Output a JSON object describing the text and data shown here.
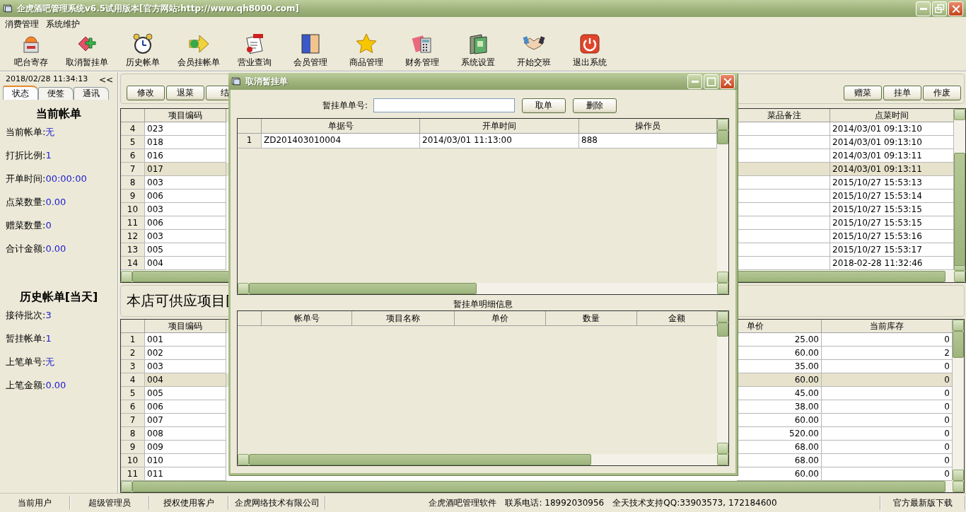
{
  "window": {
    "title": "企虎酒吧管理系统v6.5试用版本[官方网站:http://www.qh8000.com]"
  },
  "menu": [
    "消费管理",
    "系统维护"
  ],
  "toolbar": [
    {
      "label": "吧台寄存"
    },
    {
      "label": "取消暂挂单"
    },
    {
      "label": "历史帐单"
    },
    {
      "label": "会员挂帐单"
    },
    {
      "label": "营业查询"
    },
    {
      "label": "会员管理"
    },
    {
      "label": "商品管理"
    },
    {
      "label": "财务管理"
    },
    {
      "label": "系统设置"
    },
    {
      "label": "开始交班"
    },
    {
      "label": "退出系统"
    }
  ],
  "sidebar": {
    "clock": "2018/02/28 11:34:13",
    "collapse": "<<",
    "tabs": [
      {
        "label": "状态",
        "selected": true
      },
      {
        "label": "便签",
        "selected": false
      },
      {
        "label": "通讯",
        "selected": false
      }
    ],
    "sections": [
      {
        "title": "当前帐单",
        "fields": [
          {
            "label": "当前帐单:",
            "value": "无"
          },
          {
            "label": "打折比例:",
            "value": "1"
          },
          {
            "label": "开单时间:",
            "value": "00:00:00"
          },
          {
            "label": "点菜数量:",
            "value": "0.00"
          },
          {
            "label": "赠菜数量:",
            "value": "0"
          },
          {
            "label": "合计金额:",
            "value": "0.00"
          }
        ]
      },
      {
        "title": "历史帐单[当天]",
        "fields": [
          {
            "label": "接待批次:",
            "value": "3"
          },
          {
            "label": "暂挂帐单:",
            "value": "1"
          },
          {
            "label": "上笔单号:",
            "value": "无"
          },
          {
            "label": "上笔金额:",
            "value": "0.00"
          }
        ]
      }
    ]
  },
  "order_buttons_left": [
    "修改",
    "退菜",
    "结"
  ],
  "order_buttons_right": [
    "赠菜",
    "挂单",
    "作废"
  ],
  "orders_table": {
    "columns": [
      "项目编码",
      "菜品备注",
      "点菜时间"
    ],
    "rows": [
      {
        "number": "4",
        "code": "023",
        "time": "2014/03/01 09:13:10",
        "selected": false
      },
      {
        "number": "5",
        "code": "018",
        "time": "2014/03/01 09:13:10",
        "selected": false
      },
      {
        "number": "6",
        "code": "016",
        "time": "2014/03/01 09:13:11",
        "selected": false
      },
      {
        "number": "7",
        "code": "017",
        "time": "2014/03/01 09:13:11",
        "selected": true
      },
      {
        "number": "8",
        "code": "003",
        "time": "2015/10/27 15:53:13",
        "selected": false
      },
      {
        "number": "9",
        "code": "006",
        "time": "2015/10/27 15:53:14",
        "selected": false
      },
      {
        "number": "10",
        "code": "003",
        "time": "2015/10/27 15:53:15",
        "selected": false
      },
      {
        "number": "11",
        "code": "006",
        "time": "2015/10/27 15:53:15",
        "selected": false
      },
      {
        "number": "12",
        "code": "003",
        "time": "2015/10/27 15:53:16",
        "selected": false
      },
      {
        "number": "13",
        "code": "005",
        "time": "2015/10/27 15:53:17",
        "selected": false
      },
      {
        "number": "14",
        "code": "004",
        "time": "2018-02-28 11:32:46",
        "selected": false
      }
    ]
  },
  "supply_heading": "本店可供应项目[",
  "supply_table": {
    "columns": [
      "项目编码",
      "单价",
      "当前库存"
    ],
    "rows": [
      {
        "number": "1",
        "code": "001",
        "price": "25.00",
        "stock": "0",
        "selected": false
      },
      {
        "number": "2",
        "code": "002",
        "price": "60.00",
        "stock": "2",
        "selected": false
      },
      {
        "number": "3",
        "code": "003",
        "price": "35.00",
        "stock": "0",
        "selected": false
      },
      {
        "number": "4",
        "code": "004",
        "price": "60.00",
        "stock": "0",
        "selected": true
      },
      {
        "number": "5",
        "code": "005",
        "price": "45.00",
        "stock": "0",
        "selected": false
      },
      {
        "number": "6",
        "code": "006",
        "price": "38.00",
        "stock": "0",
        "selected": false
      },
      {
        "number": "7",
        "code": "007",
        "price": "60.00",
        "stock": "0",
        "selected": false
      },
      {
        "number": "8",
        "code": "008",
        "price": "520.00",
        "stock": "0",
        "selected": false
      },
      {
        "number": "9",
        "code": "009",
        "price": "68.00",
        "stock": "0",
        "selected": false
      },
      {
        "number": "10",
        "code": "010",
        "price": "68.00",
        "stock": "0",
        "selected": false
      },
      {
        "number": "11",
        "code": "011",
        "price": "60.00",
        "stock": "0",
        "selected": false
      }
    ]
  },
  "dialog": {
    "title": "取消暂挂单",
    "field_label": "暂挂单单号:",
    "buttons": [
      "取单",
      "删除"
    ],
    "pending_table": {
      "columns": [
        "单据号",
        "开单时间",
        "操作员"
      ],
      "rows": [
        {
          "number": "1",
          "cells": [
            "ZD201403010004",
            "2014/03/01 11:13:00",
            "888"
          ]
        }
      ]
    },
    "detail_title": "暂挂单明细信息",
    "detail_table": {
      "columns": [
        "帐单号",
        "项目名称",
        "单价",
        "数量",
        "金额"
      ]
    }
  },
  "status_bar": {
    "left": [
      "当前用户",
      "超级管理员",
      "授权使用客户",
      "企虎网络技术有限公司"
    ],
    "center": [
      "企虎酒吧管理软件",
      "联系电话: 18992030956",
      "全天技术支持QQ:33903573, 172184600"
    ],
    "right": "官方最新版下载"
  }
}
